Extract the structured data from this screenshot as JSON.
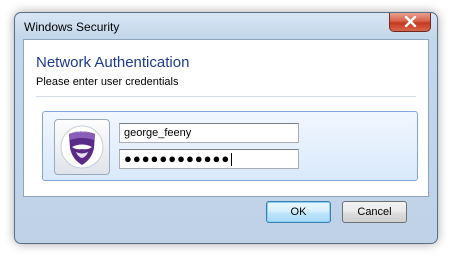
{
  "window": {
    "title": "Windows Security"
  },
  "dialog": {
    "heading": "Network Authentication",
    "subheading": "Please enter user credentials"
  },
  "credentials": {
    "username_value": "george_feeny",
    "password_mask": "●●●●●●●●●●●●"
  },
  "buttons": {
    "ok_label": "OK",
    "cancel_label": "Cancel"
  },
  "colors": {
    "heading": "#1e3b8c",
    "close_button": "#c5381f",
    "tile_border": "#7fa6d8",
    "logo_purple": "#5a2a86"
  }
}
